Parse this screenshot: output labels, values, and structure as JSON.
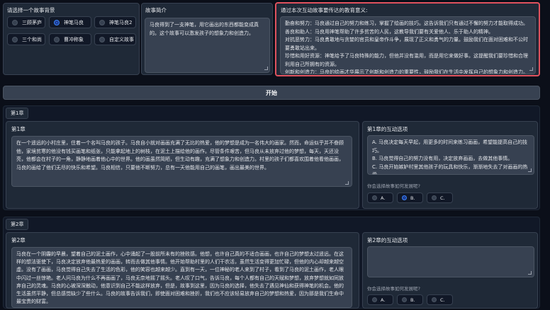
{
  "background_selector": {
    "label": "请选择一个故事背景",
    "options": [
      "三顾茅庐",
      "神笔马良",
      "神笔马良2",
      "三个和尚",
      "曹冲称象",
      "自定义故事"
    ],
    "selected": "神笔马良"
  },
  "story_intro": {
    "label": "故事简介",
    "text": "马良得到了一支神笔，用它画出的东西都能变成真的。这个故事可以激发孩子的想象力和创造力。"
  },
  "education": {
    "label": "通过本次互动故事要传达的教育意义:",
    "text": "勤奋和努力：马良通过自己的努力和练习，掌握了绘画的技巧。这告诉我们只有通过不懈的努力才能取得成功。\n善良和助人：马良用神笔帮助了许多贫苦的人民，这教导我们要有关爱他人、乐于助人的精神。\n对抗恶势力：马良勇敢地与贪婪的官员和皇帝作斗争，展现了正义和勇气的力量。鼓励我们在面对困难和不公时要勇敢站出来。\n珍惜和用好资源：神笔给予了马良特殊的能力，但他并没有滥用，而是用它来做好事。这提醒我们要珍惜和合理利用自己所拥有的资源。\n创新和创造力：马良的绘画才华展示了创新和创造力的重要性，鼓励我们在生活中发挥自己的想象力和创造力。"
  },
  "start_button": "开始",
  "chapter1": {
    "tab": "第1章",
    "label": "第1章",
    "text": "在一个遥远的小村庄里，住着一个名叫马良的孩子。马良自小就对画画充满了无比的热爱，他的梦想是成为一名伟大的画家。然而，命运似乎并不眷顾他，家境贫寒的他没有钱买画笔和纸张，只能拿起地上的树枝，在泥土上描绘他的画作。尽管条件艰苦，但马良从未放弃过他的梦想，每天，天还没亮，他都会在村子的一角，静静地画着他心中的世界。他的画虽然简陋，但生动有趣，充满了想象力和创造力。村里的孩子们都喜欢围着他看他画画，马良的画给了他们无尽的快乐和希望。马良相信，只要他不断努力，总有一天他能用自己的画笔，画出最美的世界。",
    "choices_label": "第1章的互动选项",
    "choices_text": "A. 马良决定每天早起，用更多的时间来练习画画，希望能提高自己的技巧。\nB. 马良觉得自己的努力没有用，决定放弃画画，去做其他事情。\nC. 马良开始嫉妒村里其他孩子的玩具和快乐，渐渐地失去了对画画的热爱。",
    "question": "你会选择故事如何发展呢?",
    "options": [
      "A.",
      "B.",
      "C."
    ],
    "selected": "B."
  },
  "chapter2": {
    "tab": "第2章",
    "label": "第2章",
    "text": "马良在一个阴霾的早晨，望着自己的泥土画作，心中涌起了一股前所未有的挫败感。他想，也许自己真的不适合画画，也许自己的梦想太过遥远。在这样的想法驱使下，马良决定放弃他最热爱的画画，转而去做其他事情。他开始帮助村里的人们干农活，虽然生活变得更加忙碌，但他的内心却越来越空虚。没有了画画，马良觉得自己失去了生活的色彩，他的笑容也越来越少。直到有一天，一位神秘的老人来到了村子，看到了马良的泥土画作，老人眼中闪过一丝惊艳。老人问马良为什么不再画画了，马良无奈地摇了摇头。老人叹了口气，告诉马良，每个人都有自己的天赋和梦想，放弃梦想就如同放弃自己的灵魂。马良的心被深深触动，他意识到自己不能这样放弃，但是，故事到这里，因为马良的选择，他失去了遇见神仙和获得神笔的机会。他的生活虽然平静，但总感觉缺少了些什么。马良的故事告诉我们，即使面对困难和挫折，我们也不应该轻易放弃自己的梦想和热爱，因为那是我们生命中最宝贵的财富。",
    "choices_label": "第2章的互动选项",
    "choices_text": "",
    "question": "你会选择故事如何发展呢?",
    "options": [
      "A.",
      "B.",
      "C."
    ],
    "selected": ""
  },
  "colors": {
    "accent": "#2563eb",
    "highlight_border": "#e0525e"
  }
}
